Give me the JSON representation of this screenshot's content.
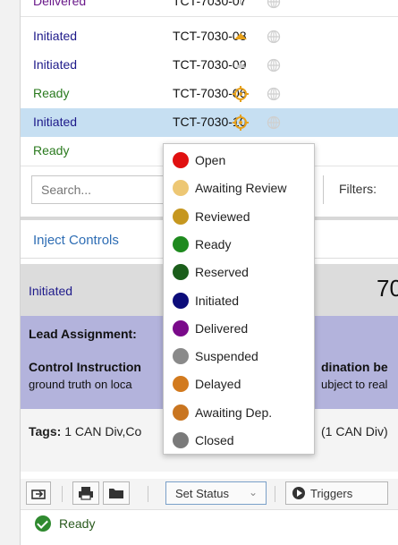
{
  "rows": [
    {
      "status": "Delivered",
      "status_class": "delivered",
      "id": "TCT-7030-07",
      "icon1": "warning-faint-icon",
      "icon2": "globe-faint-icon",
      "selected": false
    },
    {
      "status": "Initiated",
      "status_class": "initiated",
      "id": "TCT-7030-08",
      "icon1": "priority-up-orange-icon",
      "icon2": "globe-faint-icon",
      "selected": false
    },
    {
      "status": "Initiated",
      "status_class": "initiated",
      "id": "TCT-7030-09",
      "icon1": "priority-up-grey-icon",
      "icon2": "globe-faint-icon",
      "selected": false
    },
    {
      "status": "Ready",
      "status_class": "ready",
      "id": "TCT-7030-06",
      "icon1": "target-orange-icon",
      "icon2": "globe-faint-icon",
      "selected": false
    },
    {
      "status": "Initiated",
      "status_class": "initiated",
      "id": "TCT-7030-10",
      "icon1": "target-orange-icon",
      "icon2": "globe-faint-icon",
      "selected": true
    },
    {
      "status": "Ready",
      "status_class": "ready",
      "id": "",
      "icon1": "lightning-icon",
      "icon2": "globe-dark-icon",
      "selected": false
    }
  ],
  "search": {
    "placeholder": "Search..."
  },
  "filters": {
    "label": "Filters:"
  },
  "inject": {
    "title": "Inject Controls"
  },
  "status_bar": {
    "label": "Initiated",
    "number": "70"
  },
  "lead": {
    "assignment": "Lead Assignment:",
    "control_instructions": "Control Instruction",
    "coordination": "dination be",
    "ground_truth": "ground truth on loca",
    "subject": "ubject to real"
  },
  "tags": {
    "label": "Tags:",
    "value": "1 CAN Div,Co",
    "value_right": "(1 CAN Div)"
  },
  "toolbar": {
    "set_status": "Set Status",
    "triggers": "Triggers"
  },
  "bottom": {
    "status": "Ready"
  },
  "dropdown": [
    {
      "label": "Open",
      "color": "#e01010"
    },
    {
      "label": "Awaiting Review",
      "color": "#edc774"
    },
    {
      "label": "Reviewed",
      "color": "#c6971f"
    },
    {
      "label": "Ready",
      "color": "#1e8a1e"
    },
    {
      "label": "Reserved",
      "color": "#1b5e1b"
    },
    {
      "label": "Initiated",
      "color": "#0c0c7a"
    },
    {
      "label": "Delivered",
      "color": "#7a0a8a"
    },
    {
      "label": "Suspended",
      "color": "#8a8a8a"
    },
    {
      "label": "Delayed",
      "color": "#d27a1e"
    },
    {
      "label": "Awaiting Dep.",
      "color": "#c97520"
    },
    {
      "label": "Closed",
      "color": "#7a7a7a"
    }
  ]
}
